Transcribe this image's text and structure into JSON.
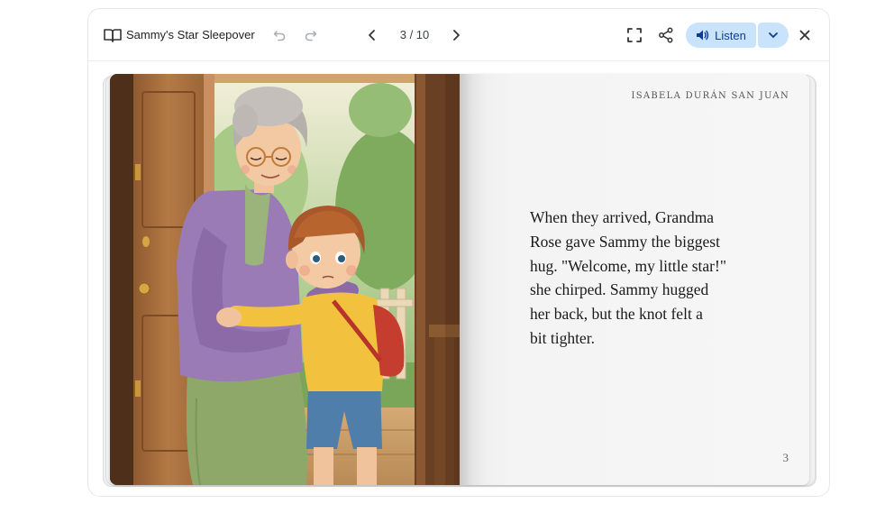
{
  "toolbar": {
    "book_title": "Sammy's Star Sleepover",
    "page_indicator": "3 / 10",
    "listen_label": "Listen"
  },
  "icons": {
    "book": "book-open-icon",
    "undo": "undo-icon",
    "redo": "redo-icon",
    "prev": "chevron-left-icon",
    "next": "chevron-right-icon",
    "fullscreen": "fullscreen-icon",
    "share": "share-icon",
    "listen": "speaker-icon",
    "dropdown": "chevron-down-icon",
    "close": "close-icon"
  },
  "colors": {
    "accent_bg": "#c8e3fb",
    "accent_text": "#0b3d91"
  },
  "page": {
    "author": "ISABELA DURÁN SAN JUAN",
    "text_lines": [
      "When they arrived, Grandma",
      "Rose gave Sammy the biggest",
      "hug. \"Welcome, my little star!\"",
      "she chirped. Sammy hugged",
      "her back, but the knot felt a",
      "bit tighter."
    ],
    "page_number": "3"
  }
}
